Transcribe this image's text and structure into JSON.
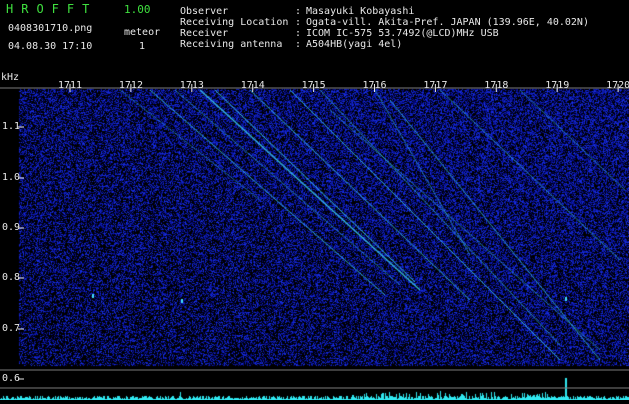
{
  "header": {
    "app_name": "HROFFT",
    "version": "1.00",
    "filename": "0408301710.png",
    "datetime": "04.08.30 17:10",
    "meteor_label": "meteor",
    "meteor_count": "1",
    "info_labels": [
      "Observer",
      "Receiving Location",
      "Receiver",
      "Receiving antenna"
    ],
    "info_seps": [
      ":",
      ":",
      ":",
      ":"
    ],
    "info_values": [
      "Masayuki Kobayashi",
      "Ogata-vill. Akita-Pref. JAPAN (139.96E, 40.02N)",
      "ICOM IC-575 53.7492(@LCD)MHz USB",
      "A504HB(yagi 4el)"
    ]
  },
  "spectrogram": {
    "y_unit": "kHz",
    "y_ticks": [
      "1.1",
      "1.0",
      "0.9",
      "0.8",
      "0.7",
      "0.6"
    ],
    "x_ticks": [
      "1711",
      "1712",
      "1713",
      "1714",
      "1715",
      "1716",
      "1717",
      "1718",
      "1719",
      "1720"
    ],
    "colors": {
      "background": "#000000",
      "noise": "#1a2cc8",
      "trace": "#40e0ff",
      "meter": "#30e8f0",
      "grid": "#7a7a7a",
      "text": "#e8e8e8",
      "title_green": "#3fe03f"
    }
  }
}
